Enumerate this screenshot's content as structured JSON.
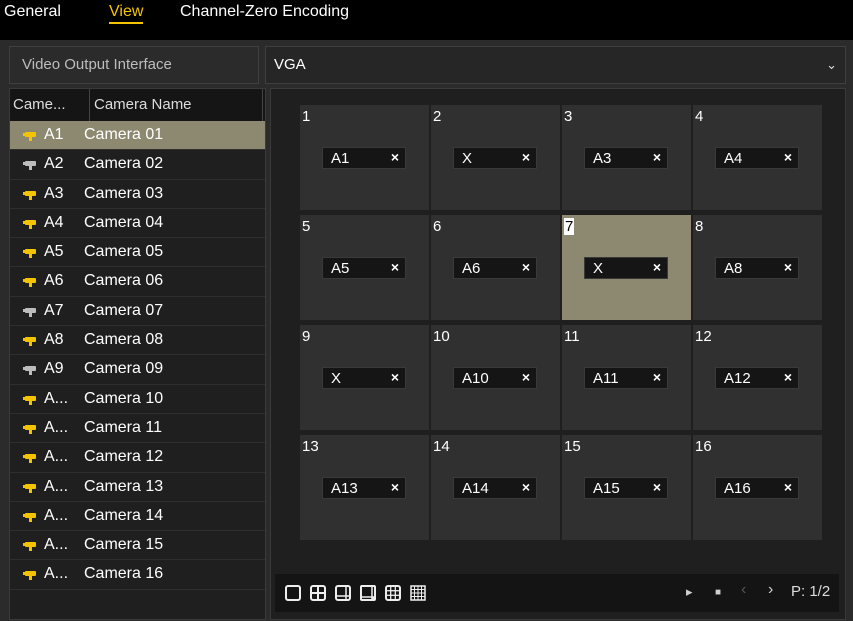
{
  "tabs": [
    {
      "label": "General",
      "active": false
    },
    {
      "label": "View",
      "active": true
    },
    {
      "label": "Channel-Zero Encoding",
      "active": false
    }
  ],
  "video_output": {
    "label": "Video Output Interface",
    "value": "VGA"
  },
  "camera_list": {
    "headers": {
      "number": "Came...",
      "name": "Camera Name"
    },
    "rows": [
      {
        "no": "A1",
        "name": "Camera 01",
        "icon": "camera-yellow-icon"
      },
      {
        "no": "A2",
        "name": "Camera 02",
        "icon": "camera-gray-icon"
      },
      {
        "no": "A3",
        "name": "Camera 03",
        "icon": "camera-yellow-icon"
      },
      {
        "no": "A4",
        "name": "Camera 04",
        "icon": "camera-yellow-icon"
      },
      {
        "no": "A5",
        "name": "Camera 05",
        "icon": "camera-yellow-icon"
      },
      {
        "no": "A6",
        "name": "Camera 06",
        "icon": "camera-yellow-icon"
      },
      {
        "no": "A7",
        "name": "Camera 07",
        "icon": "camera-gray-icon"
      },
      {
        "no": "A8",
        "name": "Camera 08",
        "icon": "camera-yellow-icon"
      },
      {
        "no": "A9",
        "name": "Camera 09",
        "icon": "camera-gray-icon"
      },
      {
        "no": "A...",
        "name": "Camera 10",
        "icon": "camera-yellow-icon"
      },
      {
        "no": "A...",
        "name": "Camera 11",
        "icon": "camera-yellow-icon"
      },
      {
        "no": "A...",
        "name": "Camera 12",
        "icon": "camera-yellow-icon"
      },
      {
        "no": "A...",
        "name": "Camera 13",
        "icon": "camera-yellow-icon"
      },
      {
        "no": "A...",
        "name": "Camera 14",
        "icon": "camera-yellow-icon"
      },
      {
        "no": "A...",
        "name": "Camera 15",
        "icon": "camera-yellow-icon"
      },
      {
        "no": "A...",
        "name": "Camera 16",
        "icon": "camera-yellow-icon"
      }
    ]
  },
  "grid": {
    "cells": [
      {
        "num": "1",
        "label": "A1"
      },
      {
        "num": "2",
        "label": "X"
      },
      {
        "num": "3",
        "label": "A3"
      },
      {
        "num": "4",
        "label": "A4"
      },
      {
        "num": "5",
        "label": "A5"
      },
      {
        "num": "6",
        "label": "A6"
      },
      {
        "num": "7",
        "label": "X"
      },
      {
        "num": "8",
        "label": "A8"
      },
      {
        "num": "9",
        "label": "X"
      },
      {
        "num": "10",
        "label": "A10"
      },
      {
        "num": "11",
        "label": "A11"
      },
      {
        "num": "12",
        "label": "A12"
      },
      {
        "num": "13",
        "label": "A13"
      },
      {
        "num": "14",
        "label": "A14"
      },
      {
        "num": "15",
        "label": "A15"
      },
      {
        "num": "16",
        "label": "A16"
      }
    ],
    "close_glyph": "×"
  },
  "toolbar": {
    "layouts": [
      "layout-1x1-icon",
      "layout-2x2-icon",
      "layout-1plus5-icon",
      "layout-1plus7-icon",
      "layout-3x3-icon",
      "layout-4x4-icon"
    ],
    "nav": {
      "play": "▸",
      "stop": "■",
      "prev": "‹",
      "next": "›"
    },
    "page": "P: 1/2"
  },
  "colors": {
    "accent": "#f5c400",
    "selected": "#8c8970",
    "camera_online": "#f5c400",
    "camera_offline": "#bdbdbd"
  }
}
